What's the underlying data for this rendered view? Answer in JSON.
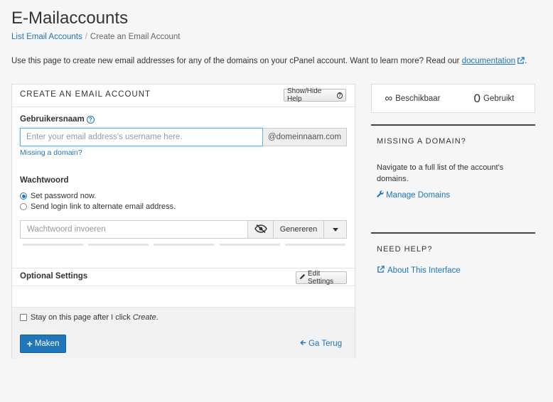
{
  "page": {
    "title": "E-Mailaccounts",
    "breadcrumb": [
      "List Email Accounts",
      "Create an Email Account"
    ],
    "intro_text": "Use this page to create new email addresses for any of the domains on your cPanel account. Want to learn more? Read our",
    "intro_link": "documentation",
    "intro_end": "."
  },
  "form": {
    "header": "CREATE AN EMAIL ACCOUNT",
    "help_button": "Show/Hide Help",
    "username_label": "Gebruikersnaam",
    "username_placeholder": "Enter your email address's username here.",
    "domain_addon": "@domeinnaam.com",
    "missing_domain_link": "Missing a domain?",
    "password_label": "Wachtwoord",
    "radio_set_now": "Set password now.",
    "radio_send_link": "Send login link to alternate email address.",
    "password_placeholder": "Wachtwoord invoeren",
    "generate_button": "Genereren",
    "optional_label": "Optional Settings",
    "edit_settings_button": "Edit Settings",
    "stay_text": "Stay on this page after I click",
    "stay_create": "Create",
    "stay_end": ".",
    "create_button": "Maken",
    "back_link": "Ga Terug"
  },
  "stats": {
    "available_symbol": "∞",
    "available_label": "Beschikbaar",
    "used_count": "0",
    "used_label": "Gebruikt"
  },
  "sidebar": {
    "missing_title": "MISSING A DOMAIN?",
    "missing_text": "Navigate to a full list of the account's domains.",
    "manage_link": "Manage Domains",
    "help_title": "NEED HELP?",
    "about_link": "About This Interface"
  },
  "colors": {
    "accent": "#1f76b8",
    "background": "#f6f6f6"
  }
}
